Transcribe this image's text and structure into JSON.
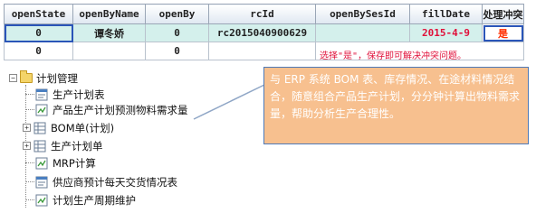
{
  "table": {
    "headers": [
      "openState",
      "openByName",
      "openBy",
      "rcId",
      "openBySesId",
      "fillDate",
      "处理冲突"
    ],
    "rows": [
      [
        "0",
        "谭冬娇",
        "0",
        "rc2015040900629",
        "",
        "2015-4-9",
        "是"
      ],
      [
        "0",
        "",
        "0",
        "",
        "",
        "",
        ""
      ]
    ],
    "note": "选择\"是\"，保存即可解决冲突问题。"
  },
  "tree": {
    "root": "计划管理",
    "items": [
      {
        "label": "生产计划表",
        "expandable": false
      },
      {
        "label": "产品生产计划预测物料需求量",
        "expandable": false
      },
      {
        "label": "BOM单(计划)",
        "expandable": true
      },
      {
        "label": "生产计划单",
        "expandable": true
      },
      {
        "label": "MRP计算",
        "expandable": false
      },
      {
        "label": "供应商预计每天交货情况表",
        "expandable": false
      },
      {
        "label": "计划生产周期维护",
        "expandable": false
      }
    ]
  },
  "callout": {
    "text": "与 ERP 系统 BOM 表、库存情况、在途材料情况结合，随意组合产品生产计划，分分钟计算出物料需求量，帮助分析生产合理性。"
  },
  "colors": {
    "header_bg": "#dfe7f1",
    "selected_row": "#d4f0ec",
    "date_red": "#e0103a",
    "callout_bg": "#f7c08f",
    "callout_border": "#4f7ab7"
  }
}
